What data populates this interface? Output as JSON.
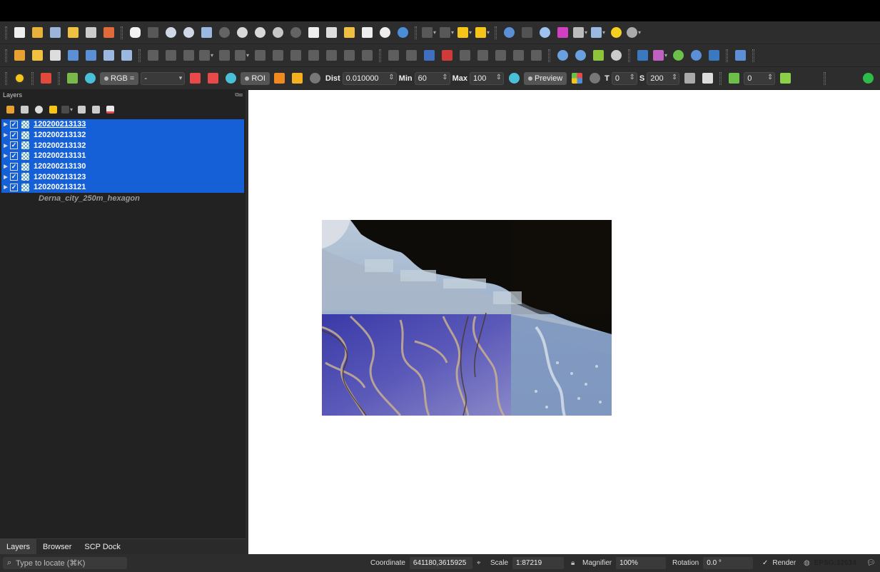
{
  "colors": {
    "selection": "#1560d6",
    "panel_bg": "#222222",
    "toolbar_bg": "#2d2d2d",
    "canvas_bg": "#ffffff"
  },
  "scp_toolbar": {
    "rgb_label": "RGB =",
    "rgb_value": "-",
    "roi_label": "ROI",
    "dist_label": "Dist",
    "dist_value": "0.010000",
    "min_label": "Min",
    "min_value": "60",
    "max_label": "Max",
    "max_value": "100",
    "preview_label": "Preview",
    "t_label": "T",
    "t_value": "0",
    "s_label": "S",
    "s_value": "200",
    "band_value": "0"
  },
  "layers_panel": {
    "title": "Layers",
    "layers": [
      {
        "name": "120200213133",
        "checked": true
      },
      {
        "name": "120200213132",
        "checked": true
      },
      {
        "name": "120200213132",
        "checked": true
      },
      {
        "name": "120200213131",
        "checked": true
      },
      {
        "name": "120200213130",
        "checked": true
      },
      {
        "name": "120200213123",
        "checked": true
      },
      {
        "name": "120200213121",
        "checked": true
      }
    ],
    "vector_layer": "Derna_city_250m_hexagon"
  },
  "dock_tabs": [
    "Layers",
    "Browser",
    "SCP Dock"
  ],
  "statusbar": {
    "locator_placeholder": "Type to locate (⌘K)",
    "coordinate_label": "Coordinate",
    "coordinate_value": "641180,3615925",
    "scale_label": "Scale",
    "scale_value": "1:87219",
    "magnifier_label": "Magnifier",
    "magnifier_value": "100%",
    "rotation_label": "Rotation",
    "rotation_value": "0.0 °",
    "render_label": "Render",
    "crs_label": "EPSG:32634"
  }
}
